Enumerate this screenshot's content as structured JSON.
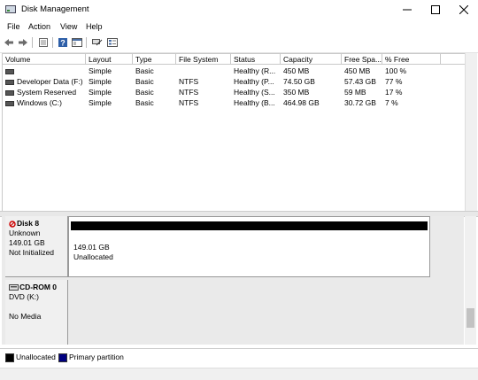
{
  "window": {
    "title": "Disk Management"
  },
  "menu": {
    "items": [
      "File",
      "Action",
      "View",
      "Help"
    ]
  },
  "volumes": {
    "columns": [
      "Volume",
      "Layout",
      "Type",
      "File System",
      "Status",
      "Capacity",
      "Free Spa...",
      "% Free"
    ],
    "rows": [
      [
        "",
        "Simple",
        "Basic",
        "",
        "Healthy (R...",
        "450 MB",
        "450 MB",
        "100 %"
      ],
      [
        "Developer Data (F:)",
        "Simple",
        "Basic",
        "NTFS",
        "Healthy (P...",
        "74.50 GB",
        "57.43 GB",
        "77 %"
      ],
      [
        "System Reserved",
        "Simple",
        "Basic",
        "NTFS",
        "Healthy (S...",
        "350 MB",
        "59 MB",
        "17 %"
      ],
      [
        "Windows (C:)",
        "Simple",
        "Basic",
        "NTFS",
        "Healthy (B...",
        "464.98 GB",
        "30.72 GB",
        "7 %"
      ]
    ]
  },
  "disks": [
    {
      "name": "Disk 8",
      "type": "Unknown",
      "size": "149.01 GB",
      "state": "Not Initialized",
      "partition_size": "149.01 GB",
      "partition_label": "Unallocated"
    },
    {
      "name": "CD-ROM 0",
      "type": "DVD (K:)",
      "size": "",
      "state": "No Media"
    }
  ],
  "legend": {
    "unallocated": "Unallocated",
    "primary": "Primary partition"
  },
  "colors": {
    "unallocated": "#000000",
    "primary": "#000080"
  },
  "icons": [
    "app-disk-icon",
    "minimize-icon",
    "maximize-icon",
    "close-icon",
    "back-arrow-icon",
    "forward-arrow-icon",
    "properties-icon",
    "help-icon",
    "console-icon",
    "rescan-icon",
    "volume-icon",
    "disk-icon",
    "cdrom-icon"
  ]
}
